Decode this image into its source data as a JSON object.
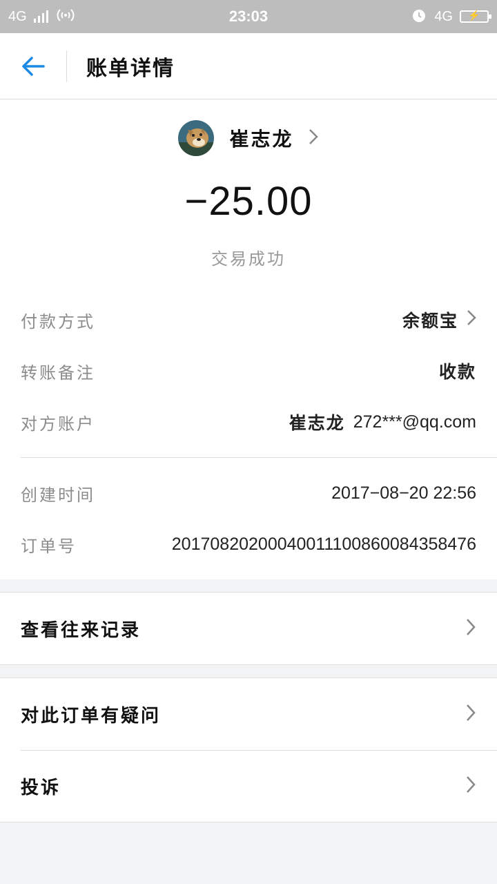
{
  "status_bar": {
    "network_left": "4G",
    "time": "23:03",
    "network_right": "4G",
    "icons": [
      "signal-icon",
      "hotspot-icon",
      "alarm-icon",
      "battery-icon"
    ]
  },
  "header": {
    "back_icon": "arrow-left-icon",
    "title": "账单详情"
  },
  "summary": {
    "payee_name": "崔志龙",
    "amount": "−25.00",
    "status": "交易成功"
  },
  "details": {
    "payment_method": {
      "label": "付款方式",
      "value": "余额宝"
    },
    "transfer_note": {
      "label": "转账备注",
      "value": "收款"
    },
    "counterparty": {
      "label": "对方账户",
      "name": "崔志龙",
      "account": "272***@qq.com"
    },
    "created_time": {
      "label": "创建时间",
      "value": "2017−08−20 22:56"
    },
    "order_no": {
      "label": "订单号",
      "value": "20170820200040011100860084358476"
    }
  },
  "menu": {
    "history": "查看往来记录",
    "question": "对此订单有疑问",
    "complaint": "投诉"
  },
  "colors": {
    "accent_blue": "#1a8ae6",
    "status_bar_bg": "#bdbdbd",
    "page_bg": "#f2f3f5"
  }
}
